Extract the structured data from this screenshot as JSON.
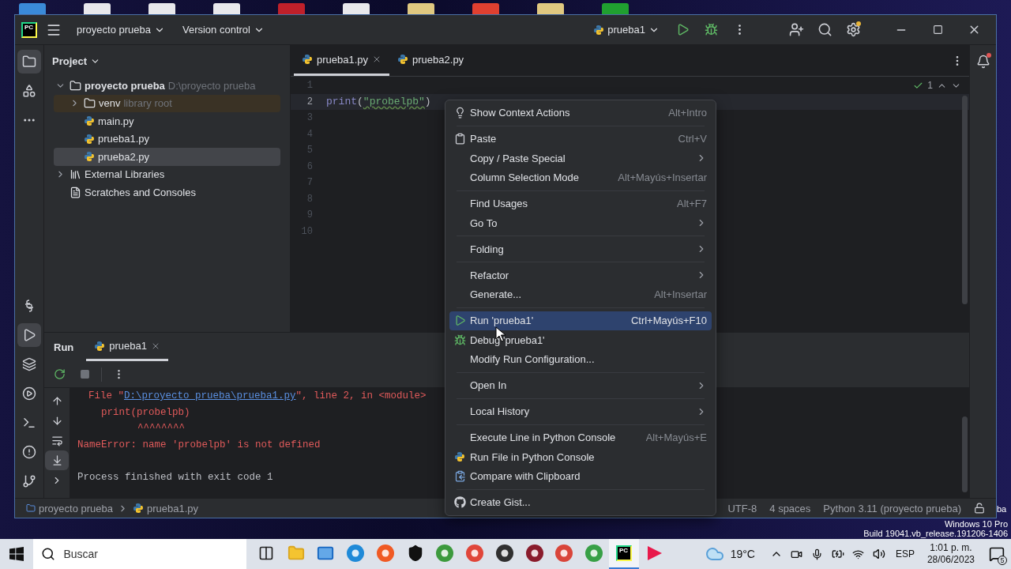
{
  "desktop": {
    "icons": [
      {
        "color": "#3a8ad8"
      },
      {
        "color": "#e8e8ec"
      },
      {
        "color": "#e8e8ec"
      },
      {
        "color": "#e8e8ec"
      },
      {
        "color": "#c0202a"
      },
      {
        "color": "#e8e8ec"
      },
      {
        "color": "#e0c880"
      },
      {
        "color": "#e04030"
      },
      {
        "color": "#e0c880"
      },
      {
        "color": "#20a030"
      }
    ],
    "fragment": "ba",
    "watermark": [
      "Windows 10 Pro",
      "Build 19041.vb_release.191206-1406"
    ]
  },
  "title_bar": {
    "logo": "PC",
    "project": "proyecto prueba",
    "vcs": "Version control",
    "run_config": "prueba1"
  },
  "tool_strip": {
    "top": [
      {
        "kind": "project",
        "selected": true
      },
      {
        "kind": "structure",
        "selected": false
      },
      {
        "kind": "more",
        "selected": false
      }
    ],
    "bottom": [
      {
        "kind": "python",
        "selected": false
      },
      {
        "kind": "run",
        "selected": true
      },
      {
        "kind": "layers",
        "selected": false
      },
      {
        "kind": "services",
        "selected": false
      },
      {
        "kind": "terminal",
        "selected": false
      },
      {
        "kind": "problems",
        "selected": false
      },
      {
        "kind": "git",
        "selected": false
      }
    ]
  },
  "project": {
    "title": "Project",
    "tree": [
      {
        "label": "proyecto prueba",
        "hint": "D:\\proyecto prueba",
        "kind": "folder",
        "expanded": true,
        "selected": false,
        "children": [
          {
            "label": "venv",
            "hint": "library root",
            "kind": "folder",
            "expanded": false,
            "excluded": true,
            "selected": false
          },
          {
            "label": "main.py",
            "kind": "python",
            "selected": false
          },
          {
            "label": "prueba1.py",
            "kind": "python",
            "selected": false
          },
          {
            "label": "prueba2.py",
            "kind": "python",
            "selected": true
          }
        ]
      },
      {
        "label": "External Libraries",
        "kind": "library",
        "expanded": false,
        "selected": false
      },
      {
        "label": "Scratches and Consoles",
        "kind": "scratches",
        "selected": false
      }
    ]
  },
  "editor": {
    "tabs": [
      {
        "label": "prueba1.py",
        "selected": true
      },
      {
        "label": "prueba2.py",
        "selected": false
      }
    ],
    "inspections": "1",
    "lines": [
      {
        "number": "1",
        "current": false
      },
      {
        "number": "2",
        "current": true,
        "code": [
          {
            "text": "print",
            "kind": "builtin"
          },
          {
            "text": "(",
            "kind": "punct"
          },
          {
            "text": "\"probelpb\"",
            "kind": "string",
            "typo": true
          },
          {
            "text": ")",
            "kind": "punct"
          }
        ]
      },
      {
        "number": "3",
        "current": false
      },
      {
        "number": "4",
        "current": false
      },
      {
        "number": "5",
        "current": false
      },
      {
        "number": "6",
        "current": false
      },
      {
        "number": "7",
        "current": false
      },
      {
        "number": "8",
        "current": false
      },
      {
        "number": "9",
        "current": false
      },
      {
        "number": "10",
        "current": false
      }
    ]
  },
  "run": {
    "title": "Run",
    "tabs": [
      {
        "label": "prueba1",
        "selected": true
      }
    ],
    "output": [
      {
        "kind": "trace",
        "parts": [
          {
            "text": "File \"",
            "link": false
          },
          {
            "text": "D:\\proyecto prueba\\prueba1.py",
            "link": true
          },
          {
            "text": "\", line 2, in <module>",
            "link": false
          }
        ]
      },
      {
        "kind": "source",
        "parts": [
          {
            "text": "print(probelpb)",
            "link": false
          }
        ]
      },
      {
        "kind": "caret",
        "parts": [
          {
            "text": "^^^^^^^^",
            "link": false
          }
        ]
      },
      {
        "kind": "error",
        "parts": [
          {
            "text": "NameError: name 'probelpb' is not defined",
            "link": false
          }
        ]
      },
      {
        "kind": "normal",
        "parts": [
          {
            "text": "Process finished with exit code 1",
            "link": false
          }
        ]
      }
    ]
  },
  "status_bar": {
    "breadcrumbs": [
      "proyecto prueba",
      "prueba1.py"
    ],
    "items": [
      "UTF-8",
      "4 spaces",
      "Python 3.11 (proyecto prueba)"
    ]
  },
  "context_menu": [
    {
      "kind": "bulb",
      "label": "Show Context Actions",
      "shortcut": "Alt+Intro",
      "submenu": false,
      "selected": false
    },
    {
      "kind": "separator"
    },
    {
      "kind": "paste",
      "label": "Paste",
      "shortcut": "Ctrl+V",
      "submenu": false,
      "selected": false
    },
    {
      "kind": "item",
      "label": "Copy / Paste Special",
      "submenu": true,
      "selected": false
    },
    {
      "kind": "item",
      "label": "Column Selection Mode",
      "shortcut": "Alt+Mayús+Insertar",
      "submenu": false,
      "selected": false
    },
    {
      "kind": "separator"
    },
    {
      "kind": "item",
      "label": "Find Usages",
      "shortcut": "Alt+F7",
      "submenu": false,
      "selected": false
    },
    {
      "kind": "item",
      "label": "Go To",
      "submenu": true,
      "selected": false
    },
    {
      "kind": "separator"
    },
    {
      "kind": "item",
      "label": "Folding",
      "submenu": true,
      "selected": false
    },
    {
      "kind": "separator"
    },
    {
      "kind": "item",
      "label": "Refactor",
      "submenu": true,
      "selected": false
    },
    {
      "kind": "item",
      "label": "Generate...",
      "shortcut": "Alt+Insertar",
      "submenu": false,
      "selected": false
    },
    {
      "kind": "separator"
    },
    {
      "kind": "run",
      "label": "Run 'prueba1'",
      "shortcut": "Ctrl+Mayús+F10",
      "submenu": false,
      "selected": true
    },
    {
      "kind": "debug",
      "label": "Debug 'prueba1'",
      "submenu": false,
      "selected": false
    },
    {
      "kind": "item",
      "label": "Modify Run Configuration...",
      "submenu": false,
      "selected": false
    },
    {
      "kind": "separator"
    },
    {
      "kind": "item",
      "label": "Open In",
      "submenu": true,
      "selected": false
    },
    {
      "kind": "separator"
    },
    {
      "kind": "item",
      "label": "Local History",
      "submenu": true,
      "selected": false
    },
    {
      "kind": "separator"
    },
    {
      "kind": "item",
      "label": "Execute Line in Python Console",
      "shortcut": "Alt+Mayús+E",
      "submenu": false,
      "selected": false
    },
    {
      "kind": "python",
      "label": "Run File in Python Console",
      "submenu": false,
      "selected": false
    },
    {
      "kind": "compare",
      "label": "Compare with Clipboard",
      "submenu": false,
      "selected": false
    },
    {
      "kind": "separator"
    },
    {
      "kind": "github",
      "label": "Create Gist...",
      "submenu": false,
      "selected": false
    }
  ],
  "taskbar": {
    "search": {
      "placeholder": "Buscar"
    },
    "apps": [
      {
        "kind": "taskview",
        "selected": false
      },
      {
        "kind": "folder",
        "selected": false
      },
      {
        "kind": "mail",
        "selected": false
      },
      {
        "kind": "round",
        "color": "#1f8ad8",
        "selected": false
      },
      {
        "kind": "round",
        "color": "#f05a24",
        "selected": false
      },
      {
        "kind": "shield",
        "selected": false
      },
      {
        "kind": "round",
        "color": "#3d9a3d",
        "selected": false
      },
      {
        "kind": "round",
        "color": "#e0463a",
        "selected": false
      },
      {
        "kind": "round",
        "color": "#303030",
        "selected": false
      },
      {
        "kind": "round",
        "color": "#8a1c2c",
        "selected": false
      },
      {
        "kind": "round",
        "color": "#d9453a",
        "selected": false
      },
      {
        "kind": "round",
        "color": "#38a046",
        "selected": false
      },
      {
        "kind": "pycharm",
        "label": "PC",
        "selected": true
      },
      {
        "kind": "play",
        "selected": false
      }
    ],
    "weather": "19°C",
    "language": "ESP",
    "time": "1:01 p. m.",
    "date": "28/06/2023",
    "notifications": "5"
  }
}
